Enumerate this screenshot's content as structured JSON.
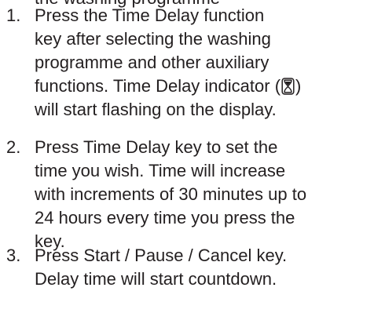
{
  "clipped_line": "the washing programme",
  "steps": [
    {
      "number": "1.",
      "lines": [
        "Press the Time Delay function",
        "key after selecting the washing",
        "programme and other auxiliary",
        "functions. Time Delay indicator (",
        ")",
        "will start flashing on the display."
      ]
    },
    {
      "number": "2.",
      "lines": [
        "Press Time Delay key to set the",
        "time you wish. Time will increase",
        "with increments of 30 minutes up to",
        "24 hours every time you press the",
        "key."
      ]
    },
    {
      "number": "3.",
      "lines": [
        "Press Start / Pause / Cancel key.",
        "Delay time will start countdown."
      ]
    }
  ],
  "icons": {
    "time_delay_indicator": "hourglass-icon"
  }
}
